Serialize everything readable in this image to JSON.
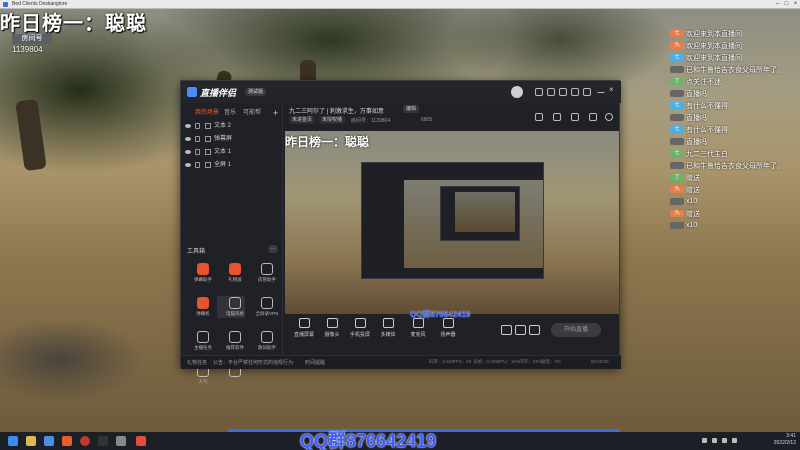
{
  "obs": {
    "title": "Bed Clients Deskangtore"
  },
  "overlay": {
    "title": "昨日榜一：聪聪",
    "room_label": "房间号",
    "room_number": "1139804"
  },
  "chat": [
    {
      "badge": "七",
      "badge_color": "#e87f4a",
      "text": "欢迎来到本直播间"
    },
    {
      "badge": "九",
      "badge_color": "#e87f4a",
      "text": "欢迎来到本直播间"
    },
    {
      "badge": "七",
      "badge_color": "#4ab0e8",
      "text": "欢迎来到本直播间"
    },
    {
      "badge": "",
      "badge_color": "#666",
      "text": "已和牛鲁恰告衣食父母所年了。"
    },
    {
      "badge": "丁",
      "badge_color": "#6cb36c",
      "text": "点关注不迷"
    },
    {
      "badge": "",
      "badge_color": "#666",
      "text": "直播吗"
    },
    {
      "badge": "七",
      "badge_color": "#4ab0e8",
      "text": "有什么不懂得"
    },
    {
      "badge": "",
      "badge_color": "#666",
      "text": "直播吗"
    },
    {
      "badge": "七",
      "badge_color": "#4ab0e8",
      "text": "有什么不懂得"
    },
    {
      "badge": "",
      "badge_color": "#666",
      "text": "直播吗"
    },
    {
      "badge": "七",
      "badge_color": "#6cb36c",
      "text": "九二三代主白"
    },
    {
      "badge": "",
      "badge_color": "#666",
      "text": "已和牛鲁恰告衣食父母所年了。"
    },
    {
      "badge": "丁",
      "badge_color": "#6cb36c",
      "text": "赠送"
    },
    {
      "badge": "九",
      "badge_color": "#e87f4a",
      "text": "赠送"
    },
    {
      "badge": "",
      "badge_color": "#666",
      "text": "x10"
    },
    {
      "badge": "九",
      "badge_color": "#e87f4a",
      "text": "赠送"
    },
    {
      "badge": "",
      "badge_color": "#666",
      "text": "x10"
    }
  ],
  "app": {
    "name": "直播伴侣",
    "version": "测试版",
    "tabs": [
      "我的场景",
      "音乐",
      "可能帮"
    ],
    "sources": [
      "文本 2",
      "弹幕屏",
      "文本 1",
      "全屏 1"
    ],
    "tools_title": "工具箱",
    "tools_more": "···",
    "tools": [
      {
        "label": "弹幕助手",
        "style": "red"
      },
      {
        "label": "礼物屏",
        "style": "red"
      },
      {
        "label": "房管助手",
        "style": "line"
      },
      {
        "label": "弹幕机",
        "style": "red"
      },
      {
        "label": "电脑风格",
        "style": "line"
      },
      {
        "label": "全屏录VPN",
        "style": "line"
      },
      {
        "label": "主播任务",
        "style": "line"
      },
      {
        "label": "推荐软件",
        "style": "line"
      },
      {
        "label": "歌词助手",
        "style": "line"
      },
      {
        "label": "人气",
        "style": "line"
      },
      {
        "label": "",
        "style": "line"
      }
    ],
    "stream_title": "九二三阿尔了 | 刺激求生，万事如意",
    "edit_label": "编辑",
    "meta": {
      "pill1": "未进首页",
      "pill2": "未授权播",
      "room": "房间号：1139804",
      "viewers": "6805"
    },
    "preview_title": "昨日榜一：聪聪",
    "controls": [
      "直播屏幕",
      "摄像头",
      "手机投屏",
      "多媒体",
      "麦克风",
      "扬声器"
    ],
    "start_label": "开始直播",
    "status_texts": [
      "礼物任务",
      "公告：平台严禁任何形式的违规行为",
      "时间提醒"
    ],
    "stats": [
      "码率：0 kb/s",
      "FPS：60",
      "丢帧：0.00%",
      "CPU：16%",
      "内存：33%",
      "磁盘：0%",
      "00:00:00"
    ]
  },
  "watermark": {
    "small": "QQ群876642419",
    "big": "QQ群876642419"
  },
  "taskbar": {
    "time": "3:41",
    "date": "2022/2/12"
  }
}
